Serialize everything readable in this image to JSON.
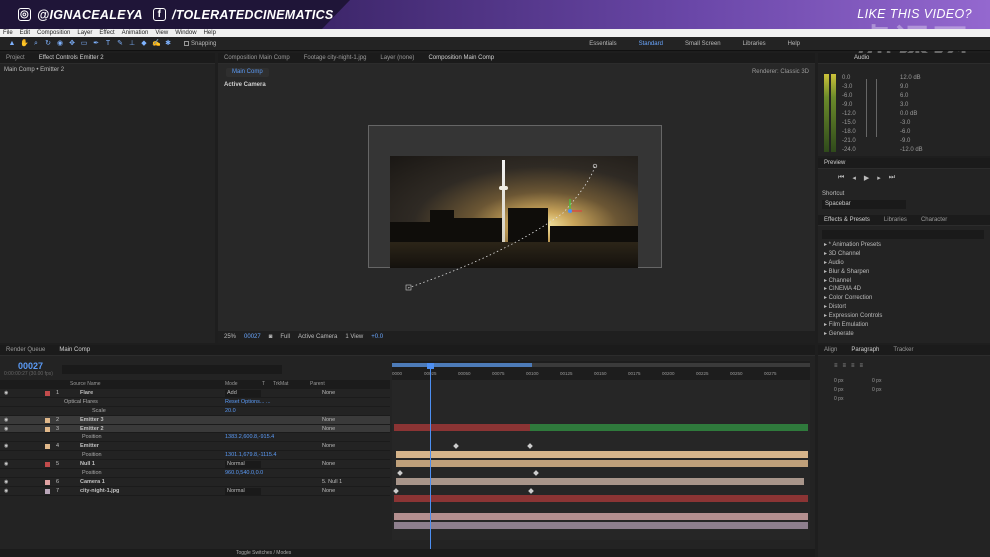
{
  "banner": {
    "instagram": "@IGNACEALEYA",
    "facebook": "/TOLERATEDCINEMATICS",
    "cta": "LIKE THIS VIDEO?",
    "watermark": "虎课网"
  },
  "menu": [
    "File",
    "Edit",
    "Composition",
    "Layer",
    "Effect",
    "Animation",
    "View",
    "Window",
    "Help"
  ],
  "toolbar": {
    "snapping": "Snapping",
    "workspaces": [
      "Essentials",
      "Standard",
      "Small Screen",
      "Libraries",
      "Help"
    ],
    "active_workspace": "Standard"
  },
  "project": {
    "tabs": [
      "Project",
      "Effect Controls Emitter 2"
    ],
    "breadcrumb": "Main Comp • Emitter 2"
  },
  "comp": {
    "tabs": [
      "Composition Main Comp",
      "Footage city-night-1.jpg",
      "Layer (none)",
      "Composition Main Comp"
    ],
    "chip": "Main Comp",
    "renderer": "Renderer: Classic 3D",
    "camera": "Active Camera",
    "viewbar": {
      "zoom": "25%",
      "time": "00027",
      "res": "Full",
      "camera": "Active Camera",
      "views": "1 View",
      "exposure": "+0.0"
    }
  },
  "audio": {
    "tab": "Audio",
    "left_scale": [
      "0.0",
      "-3.0",
      "-6.0",
      "-9.0",
      "-12.0",
      "-15.0",
      "-18.0",
      "-21.0",
      "-24.0"
    ],
    "right_scale": [
      "12.0 dB",
      "9.0",
      "6.0",
      "3.0",
      "0.0 dB",
      "-3.0",
      "-6.0",
      "-9.0",
      "-12.0 dB"
    ]
  },
  "preview": {
    "tab": "Preview",
    "shortcut_label": "Shortcut",
    "shortcut_value": "Spacebar"
  },
  "effects": {
    "tabs": [
      "Effects & Presets",
      "Libraries",
      "Character"
    ],
    "items": [
      "▸ * Animation Presets",
      "▸ 3D Channel",
      "▸ Audio",
      "▸ Blur & Sharpen",
      "▸ Channel",
      "▸ CINEMA 4D",
      "▸ Color Correction",
      "▸ Distort",
      "▸ Expression Controls",
      "▸ Film Emulation",
      "▸ Generate"
    ]
  },
  "timeline": {
    "tabs": [
      "Render Queue",
      "Main Comp"
    ],
    "timecode": "00027",
    "fps": "0:00:00:27 (30.00 fps)",
    "columns": {
      "source": "Source Name",
      "mode": "Mode",
      "t": "T",
      "trkmat": "TrkMat",
      "parent": "Parent"
    },
    "ruler": [
      "0000",
      "00025",
      "00050",
      "00075",
      "00100",
      "00125",
      "00150",
      "00175",
      "00200",
      "00225",
      "00250",
      "00275"
    ],
    "footer": "Toggle Switches / Modes",
    "layers": [
      {
        "num": "1",
        "name": "Flare",
        "mode": "Add",
        "parent": "None",
        "color": "#c24b4b"
      },
      {
        "prop": "Optical Flares",
        "val": "Reset   Options...     ..."
      },
      {
        "prop": "Scale",
        "val": "20.0"
      },
      {
        "num": "2",
        "name": "Emitter 3",
        "parent": "None",
        "color": "#e0b88a"
      },
      {
        "num": "3",
        "name": "Emitter 2",
        "parent": "None",
        "color": "#e0b88a"
      },
      {
        "prop": "Position",
        "val": "1383.2,600.8,-915.4"
      },
      {
        "num": "4",
        "name": "Emitter",
        "parent": "None",
        "color": "#e0b88a"
      },
      {
        "prop": "Position",
        "val": "1301.1,679.8,-1115.4"
      },
      {
        "num": "5",
        "name": "Null 1",
        "mode": "Normal",
        "parent": "None",
        "color": "#c24b4b"
      },
      {
        "prop": "Position",
        "val": "960.0,540.0,0.0"
      },
      {
        "num": "6",
        "name": "Camera 1",
        "parent": "5. Null 1",
        "color": "#e0a3a3"
      },
      {
        "num": "7",
        "name": "city-night-1.jpg",
        "mode": "Normal",
        "parent": "None",
        "color": "#b9a6b8"
      }
    ]
  },
  "para": {
    "tabs": [
      "Align",
      "Paragraph",
      "Tracker"
    ],
    "values": [
      "0 px",
      "0 px",
      "0 px",
      "0 px",
      "0 px"
    ]
  }
}
